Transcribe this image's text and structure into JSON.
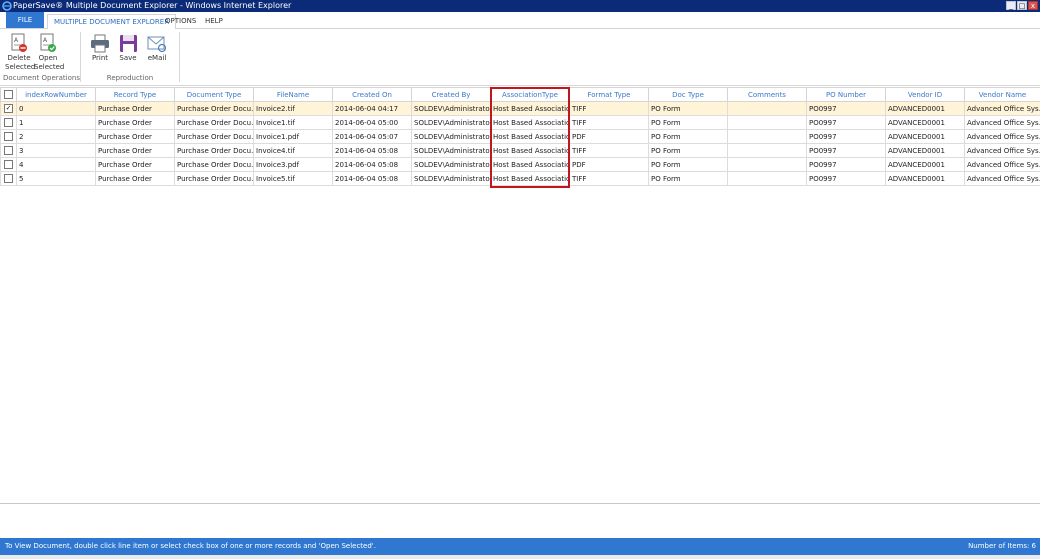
{
  "window": {
    "title": "PaperSave® Multiple Document Explorer - Windows Internet Explorer",
    "min_label": "_",
    "max_label": "□",
    "close_label": "x"
  },
  "tabs": {
    "file": "FILE",
    "mde": "MULTIPLE DOCUMENT EXPLORER",
    "options": "OPTIONS",
    "help": "HELP"
  },
  "ribbon": {
    "delete_line1": "Delete",
    "delete_line2": "Selected",
    "open_line1": "Open",
    "open_line2": "Selected",
    "group1_label": "Document Operations",
    "print_label": "Print",
    "save_label": "Save",
    "email_label": "eMail",
    "group2_label": "Reproduction"
  },
  "grid": {
    "columns": [
      "indexRowNumber",
      "Record Type",
      "Document Type",
      "FileName",
      "Created On",
      "Created By",
      "AssociationType",
      "Format Type",
      "Doc Type",
      "Comments",
      "PO Number",
      "Vendor ID",
      "Vendor Name"
    ],
    "rows": [
      {
        "checked": "✓",
        "cells": [
          "0",
          "Purchase Order",
          "Purchase Order Docu...",
          "Invoice2.tif",
          "2014-06-04 04:17",
          "SOLDEV\\Administrator",
          "Host Based Association",
          "TIFF",
          "PO Form",
          "",
          "PO0997",
          "ADVANCED0001",
          "Advanced Office Sys..."
        ]
      },
      {
        "checked": "",
        "cells": [
          "1",
          "Purchase Order",
          "Purchase Order Docu...",
          "Invoice1.tif",
          "2014-06-04 05:00",
          "SOLDEV\\Administrator",
          "Host Based Association",
          "TIFF",
          "PO Form",
          "",
          "PO0997",
          "ADVANCED0001",
          "Advanced Office Sys..."
        ]
      },
      {
        "checked": "",
        "cells": [
          "2",
          "Purchase Order",
          "Purchase Order Docu...",
          "Invoice1.pdf",
          "2014-06-04 05:07",
          "SOLDEV\\Administrator",
          "Host Based Association",
          "PDF",
          "PO Form",
          "",
          "PO0997",
          "ADVANCED0001",
          "Advanced Office Sys..."
        ]
      },
      {
        "checked": "",
        "cells": [
          "3",
          "Purchase Order",
          "Purchase Order Docu...",
          "Invoice4.tif",
          "2014-06-04 05:08",
          "SOLDEV\\Administrator",
          "Host Based Association",
          "TIFF",
          "PO Form",
          "",
          "PO0997",
          "ADVANCED0001",
          "Advanced Office Sys..."
        ]
      },
      {
        "checked": "",
        "cells": [
          "4",
          "Purchase Order",
          "Purchase Order Docu...",
          "Invoice3.pdf",
          "2014-06-04 05:08",
          "SOLDEV\\Administrator",
          "Host Based Association",
          "PDF",
          "PO Form",
          "",
          "PO0997",
          "ADVANCED0001",
          "Advanced Office Sys..."
        ]
      },
      {
        "checked": "",
        "cells": [
          "5",
          "Purchase Order",
          "Purchase Order Docu...",
          "Invoice5.tif",
          "2014-06-04 05:08",
          "SOLDEV\\Administrator",
          "Host Based Association",
          "TIFF",
          "PO Form",
          "",
          "PO0997",
          "ADVANCED0001",
          "Advanced Office Sys..."
        ]
      }
    ]
  },
  "status": {
    "message": "To View Document, double click line item or select check box of one or more records and 'Open Selected'.",
    "count": "Number of Items: 6"
  },
  "colors": {
    "accent": "#2f77d0",
    "titlebar": "#0b2a78",
    "header_text": "#3d78c8",
    "highlight_box": "#c0161d",
    "selected_row": "#fff3d8"
  }
}
